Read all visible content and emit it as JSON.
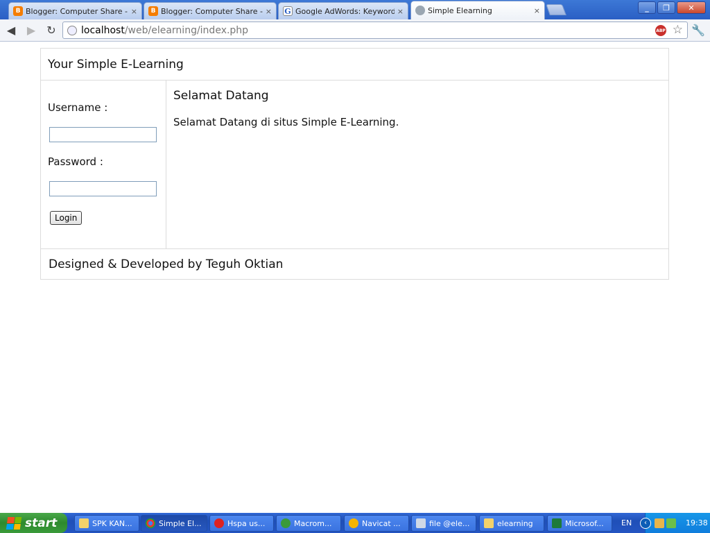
{
  "browser": {
    "tabs": [
      {
        "title": "Blogger: Computer Share - All",
        "icon": "blogger-icon",
        "active": false
      },
      {
        "title": "Blogger: Computer Share - Cre",
        "icon": "blogger-icon",
        "active": false
      },
      {
        "title": "Google AdWords: Keyword To",
        "icon": "google-icon",
        "active": false
      },
      {
        "title": "Simple Elearning",
        "icon": "globe-icon",
        "active": true
      }
    ],
    "close_glyph": "×",
    "url_host": "localhost",
    "url_path": "/web/elearning/index.php",
    "abp_label": "ABP"
  },
  "site": {
    "header_title": "Your Simple E-Learning",
    "username_label": "Username :",
    "username_value": "",
    "password_label": "Password :",
    "password_value": "",
    "login_button": "Login",
    "content_heading": "Selamat Datang",
    "content_text": "Selamat Datang di situs Simple E-Learning.",
    "footer_text": "Designed & Developed by Teguh Oktian"
  },
  "taskbar": {
    "start_label": "start",
    "items": [
      {
        "label": "SPK KAN...",
        "icon": "folder-icon",
        "active": false
      },
      {
        "label": "Simple El...",
        "icon": "chrome-icon",
        "active": true
      },
      {
        "label": "Hspa us...",
        "icon": "modem-icon",
        "active": false
      },
      {
        "label": "Macrom...",
        "icon": "dreamweaver-icon",
        "active": false
      },
      {
        "label": "Navicat ...",
        "icon": "navicat-icon",
        "active": false
      },
      {
        "label": "file @ele...",
        "icon": "notepad-icon",
        "active": false
      },
      {
        "label": "elearning",
        "icon": "folder-icon",
        "active": false
      },
      {
        "label": "Microsof...",
        "icon": "excel-icon",
        "active": false
      }
    ],
    "language": "EN",
    "clock": "19:38"
  }
}
